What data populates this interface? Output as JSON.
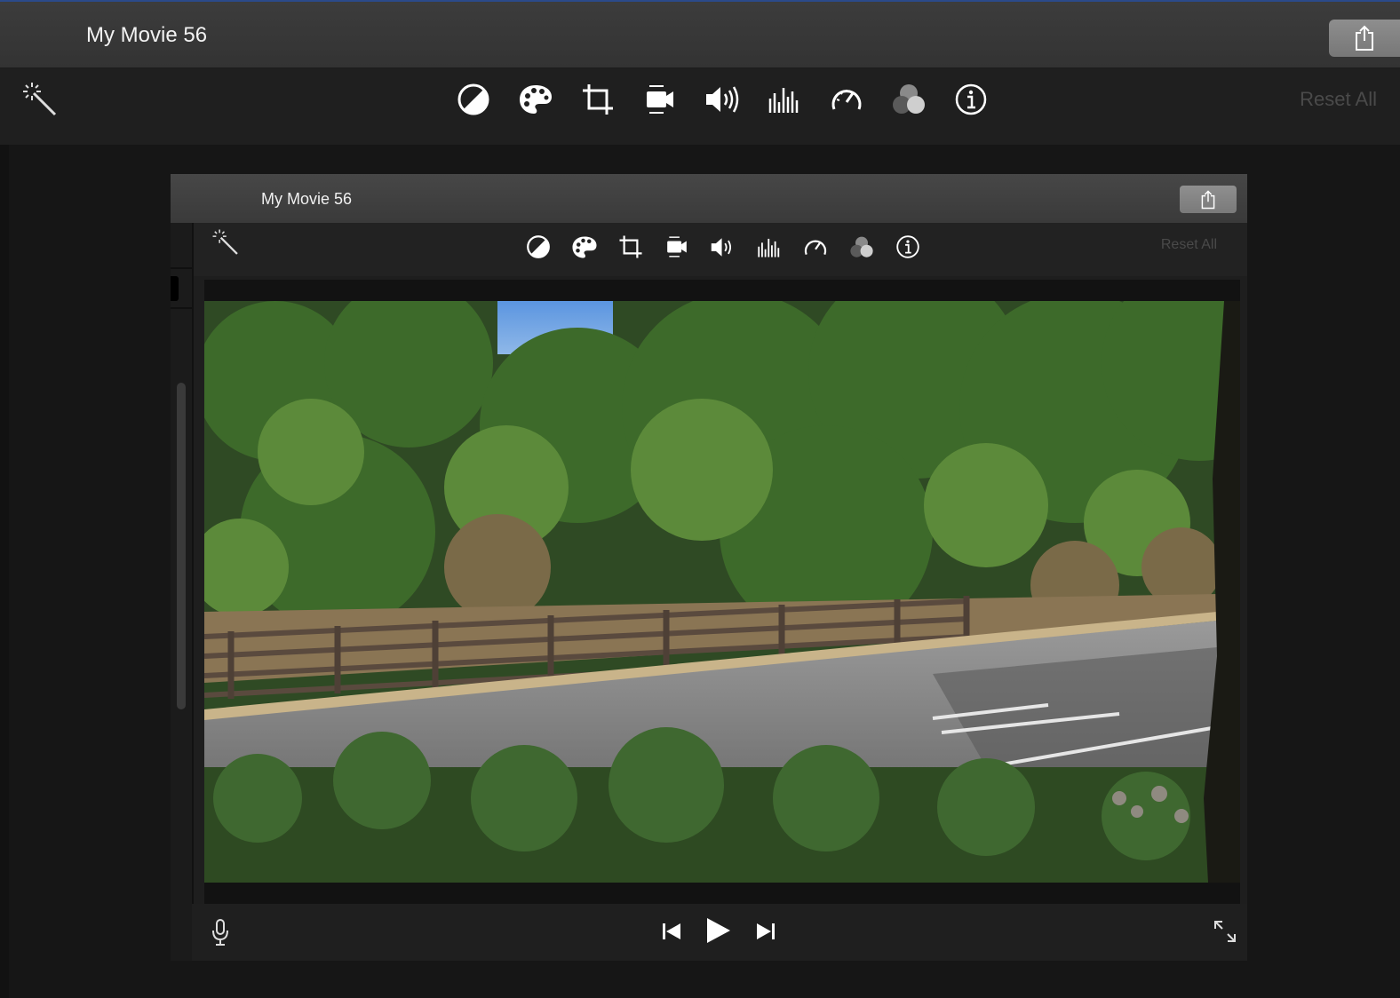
{
  "window": {
    "title": "My Movie 56"
  },
  "toolbar": {
    "tools": [
      "color-balance-icon",
      "color-correction-icon",
      "crop-icon",
      "stabilization-icon",
      "volume-icon",
      "noise-reduction-icon",
      "speed-icon",
      "clip-filter-icon",
      "clip-info-icon"
    ],
    "reset_label": "Reset All"
  },
  "inner_window": {
    "title": "My Movie 56",
    "reset_label": "Reset All"
  },
  "playback": {
    "controls": [
      "microphone-icon",
      "skip-back-icon",
      "play-icon",
      "skip-forward-icon",
      "fullscreen-icon"
    ]
  },
  "colors": {
    "titlebar": "#383838",
    "toolbar": "#1f1f1f",
    "accent": "#2b4a8a"
  }
}
